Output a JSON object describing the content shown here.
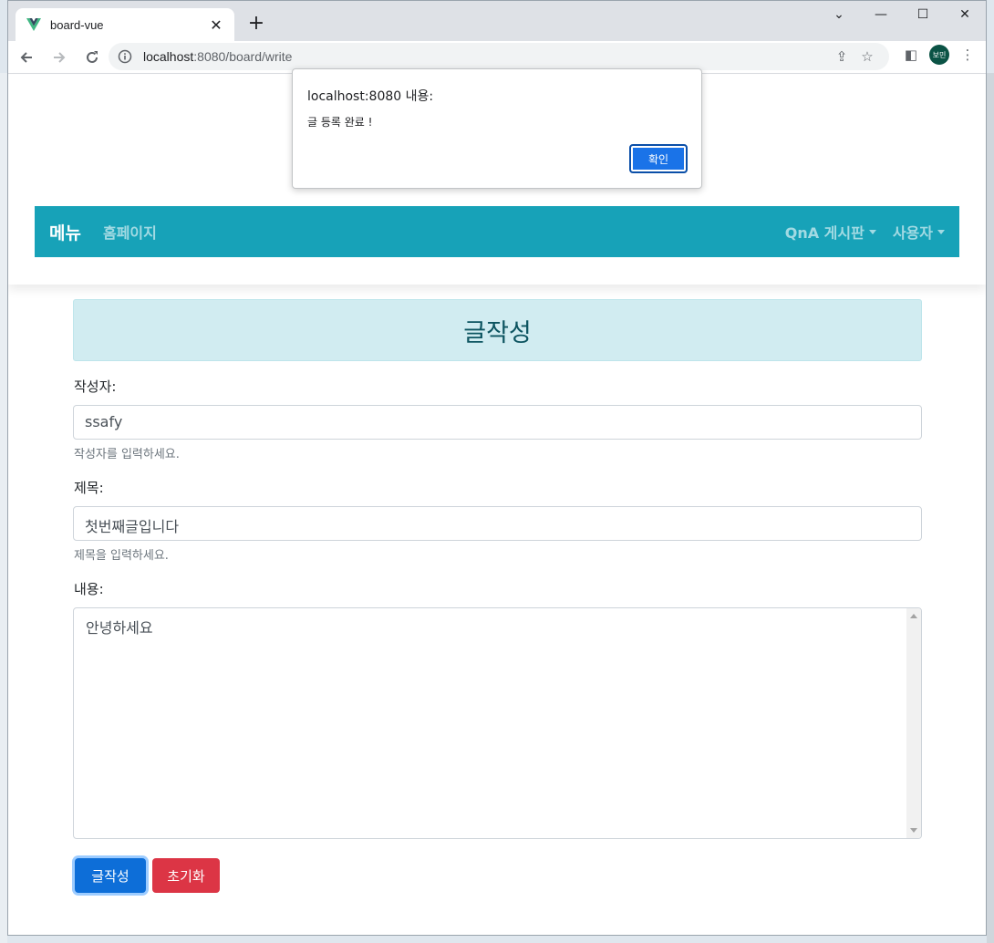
{
  "browser": {
    "tab_title": "board-vue",
    "new_tab": "+",
    "url_host": "localhost",
    "url_path": ":8080/board/write",
    "profile_initials": "보민",
    "window_controls": [
      "⌄",
      "—",
      "☐",
      "✕"
    ]
  },
  "navbar": {
    "brand": "메뉴",
    "home": "홈페이지",
    "qna": "QnA 게시판",
    "user": "사용자"
  },
  "form": {
    "title": "글작성",
    "writer_label": "작성자:",
    "writer_value": "ssafy",
    "writer_hint": "작성자를 입력하세요.",
    "subject_label": "제목:",
    "subject_value": "첫번째글입니다",
    "subject_hint": "제목을 입력하세요.",
    "content_label": "내용:",
    "content_value": "안녕하세요",
    "submit_label": "글작성",
    "reset_label": "초기화"
  },
  "dialog": {
    "title": "localhost:8080 내용:",
    "message": "글 등록 완료 !",
    "ok_label": "확인"
  },
  "colors": {
    "navbar": "#17a2b8",
    "alert_info": "#d1ecf1",
    "primary": "#0d6ed8",
    "danger": "#dc3545"
  }
}
